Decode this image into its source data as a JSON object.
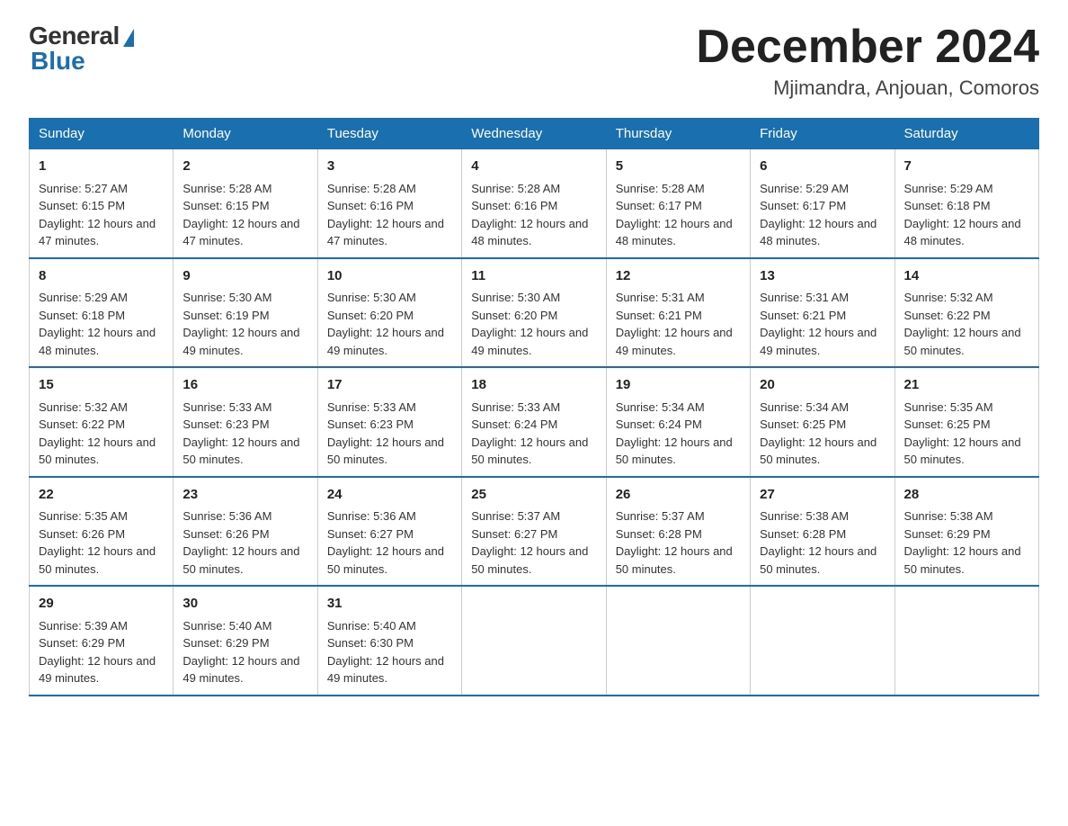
{
  "header": {
    "logo": {
      "general": "General",
      "blue": "Blue"
    },
    "title": "December 2024",
    "location": "Mjimandra, Anjouan, Comoros"
  },
  "days_of_week": [
    "Sunday",
    "Monday",
    "Tuesday",
    "Wednesday",
    "Thursday",
    "Friday",
    "Saturday"
  ],
  "weeks": [
    [
      {
        "day": "1",
        "sunrise": "5:27 AM",
        "sunset": "6:15 PM",
        "daylight": "12 hours and 47 minutes."
      },
      {
        "day": "2",
        "sunrise": "5:28 AM",
        "sunset": "6:15 PM",
        "daylight": "12 hours and 47 minutes."
      },
      {
        "day": "3",
        "sunrise": "5:28 AM",
        "sunset": "6:16 PM",
        "daylight": "12 hours and 47 minutes."
      },
      {
        "day": "4",
        "sunrise": "5:28 AM",
        "sunset": "6:16 PM",
        "daylight": "12 hours and 48 minutes."
      },
      {
        "day": "5",
        "sunrise": "5:28 AM",
        "sunset": "6:17 PM",
        "daylight": "12 hours and 48 minutes."
      },
      {
        "day": "6",
        "sunrise": "5:29 AM",
        "sunset": "6:17 PM",
        "daylight": "12 hours and 48 minutes."
      },
      {
        "day": "7",
        "sunrise": "5:29 AM",
        "sunset": "6:18 PM",
        "daylight": "12 hours and 48 minutes."
      }
    ],
    [
      {
        "day": "8",
        "sunrise": "5:29 AM",
        "sunset": "6:18 PM",
        "daylight": "12 hours and 48 minutes."
      },
      {
        "day": "9",
        "sunrise": "5:30 AM",
        "sunset": "6:19 PM",
        "daylight": "12 hours and 49 minutes."
      },
      {
        "day": "10",
        "sunrise": "5:30 AM",
        "sunset": "6:20 PM",
        "daylight": "12 hours and 49 minutes."
      },
      {
        "day": "11",
        "sunrise": "5:30 AM",
        "sunset": "6:20 PM",
        "daylight": "12 hours and 49 minutes."
      },
      {
        "day": "12",
        "sunrise": "5:31 AM",
        "sunset": "6:21 PM",
        "daylight": "12 hours and 49 minutes."
      },
      {
        "day": "13",
        "sunrise": "5:31 AM",
        "sunset": "6:21 PM",
        "daylight": "12 hours and 49 minutes."
      },
      {
        "day": "14",
        "sunrise": "5:32 AM",
        "sunset": "6:22 PM",
        "daylight": "12 hours and 50 minutes."
      }
    ],
    [
      {
        "day": "15",
        "sunrise": "5:32 AM",
        "sunset": "6:22 PM",
        "daylight": "12 hours and 50 minutes."
      },
      {
        "day": "16",
        "sunrise": "5:33 AM",
        "sunset": "6:23 PM",
        "daylight": "12 hours and 50 minutes."
      },
      {
        "day": "17",
        "sunrise": "5:33 AM",
        "sunset": "6:23 PM",
        "daylight": "12 hours and 50 minutes."
      },
      {
        "day": "18",
        "sunrise": "5:33 AM",
        "sunset": "6:24 PM",
        "daylight": "12 hours and 50 minutes."
      },
      {
        "day": "19",
        "sunrise": "5:34 AM",
        "sunset": "6:24 PM",
        "daylight": "12 hours and 50 minutes."
      },
      {
        "day": "20",
        "sunrise": "5:34 AM",
        "sunset": "6:25 PM",
        "daylight": "12 hours and 50 minutes."
      },
      {
        "day": "21",
        "sunrise": "5:35 AM",
        "sunset": "6:25 PM",
        "daylight": "12 hours and 50 minutes."
      }
    ],
    [
      {
        "day": "22",
        "sunrise": "5:35 AM",
        "sunset": "6:26 PM",
        "daylight": "12 hours and 50 minutes."
      },
      {
        "day": "23",
        "sunrise": "5:36 AM",
        "sunset": "6:26 PM",
        "daylight": "12 hours and 50 minutes."
      },
      {
        "day": "24",
        "sunrise": "5:36 AM",
        "sunset": "6:27 PM",
        "daylight": "12 hours and 50 minutes."
      },
      {
        "day": "25",
        "sunrise": "5:37 AM",
        "sunset": "6:27 PM",
        "daylight": "12 hours and 50 minutes."
      },
      {
        "day": "26",
        "sunrise": "5:37 AM",
        "sunset": "6:28 PM",
        "daylight": "12 hours and 50 minutes."
      },
      {
        "day": "27",
        "sunrise": "5:38 AM",
        "sunset": "6:28 PM",
        "daylight": "12 hours and 50 minutes."
      },
      {
        "day": "28",
        "sunrise": "5:38 AM",
        "sunset": "6:29 PM",
        "daylight": "12 hours and 50 minutes."
      }
    ],
    [
      {
        "day": "29",
        "sunrise": "5:39 AM",
        "sunset": "6:29 PM",
        "daylight": "12 hours and 49 minutes."
      },
      {
        "day": "30",
        "sunrise": "5:40 AM",
        "sunset": "6:29 PM",
        "daylight": "12 hours and 49 minutes."
      },
      {
        "day": "31",
        "sunrise": "5:40 AM",
        "sunset": "6:30 PM",
        "daylight": "12 hours and 49 minutes."
      },
      null,
      null,
      null,
      null
    ]
  ],
  "labels": {
    "sunrise": "Sunrise:",
    "sunset": "Sunset:",
    "daylight": "Daylight:"
  }
}
